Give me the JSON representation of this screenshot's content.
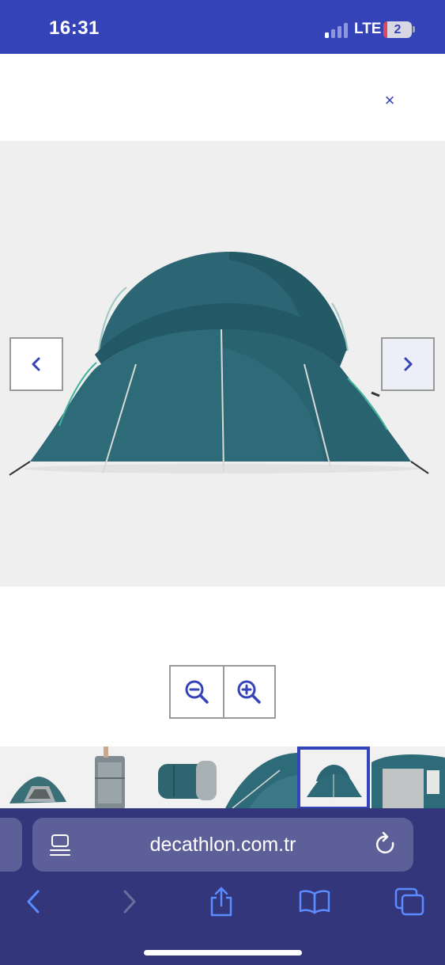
{
  "status_bar": {
    "time": "16:31",
    "network": "LTE",
    "battery": "2"
  },
  "gallery": {
    "close_label": "×",
    "main_image_alt": "Tent front view",
    "thumbnails": [
      {
        "name": "tent-overview"
      },
      {
        "name": "tent-packed-bag"
      },
      {
        "name": "tent-inner-room"
      },
      {
        "name": "tent-side-closeup"
      },
      {
        "name": "tent-front-view"
      },
      {
        "name": "tent-interior-door"
      }
    ],
    "active_thumbnail": 4
  },
  "safari": {
    "url": "decathlon.com.tr"
  },
  "colors": {
    "accent": "#3443b8",
    "toolbar_bg": "#33367a",
    "url_bg": "#5d6098",
    "tent_main": "#2e6b78"
  }
}
